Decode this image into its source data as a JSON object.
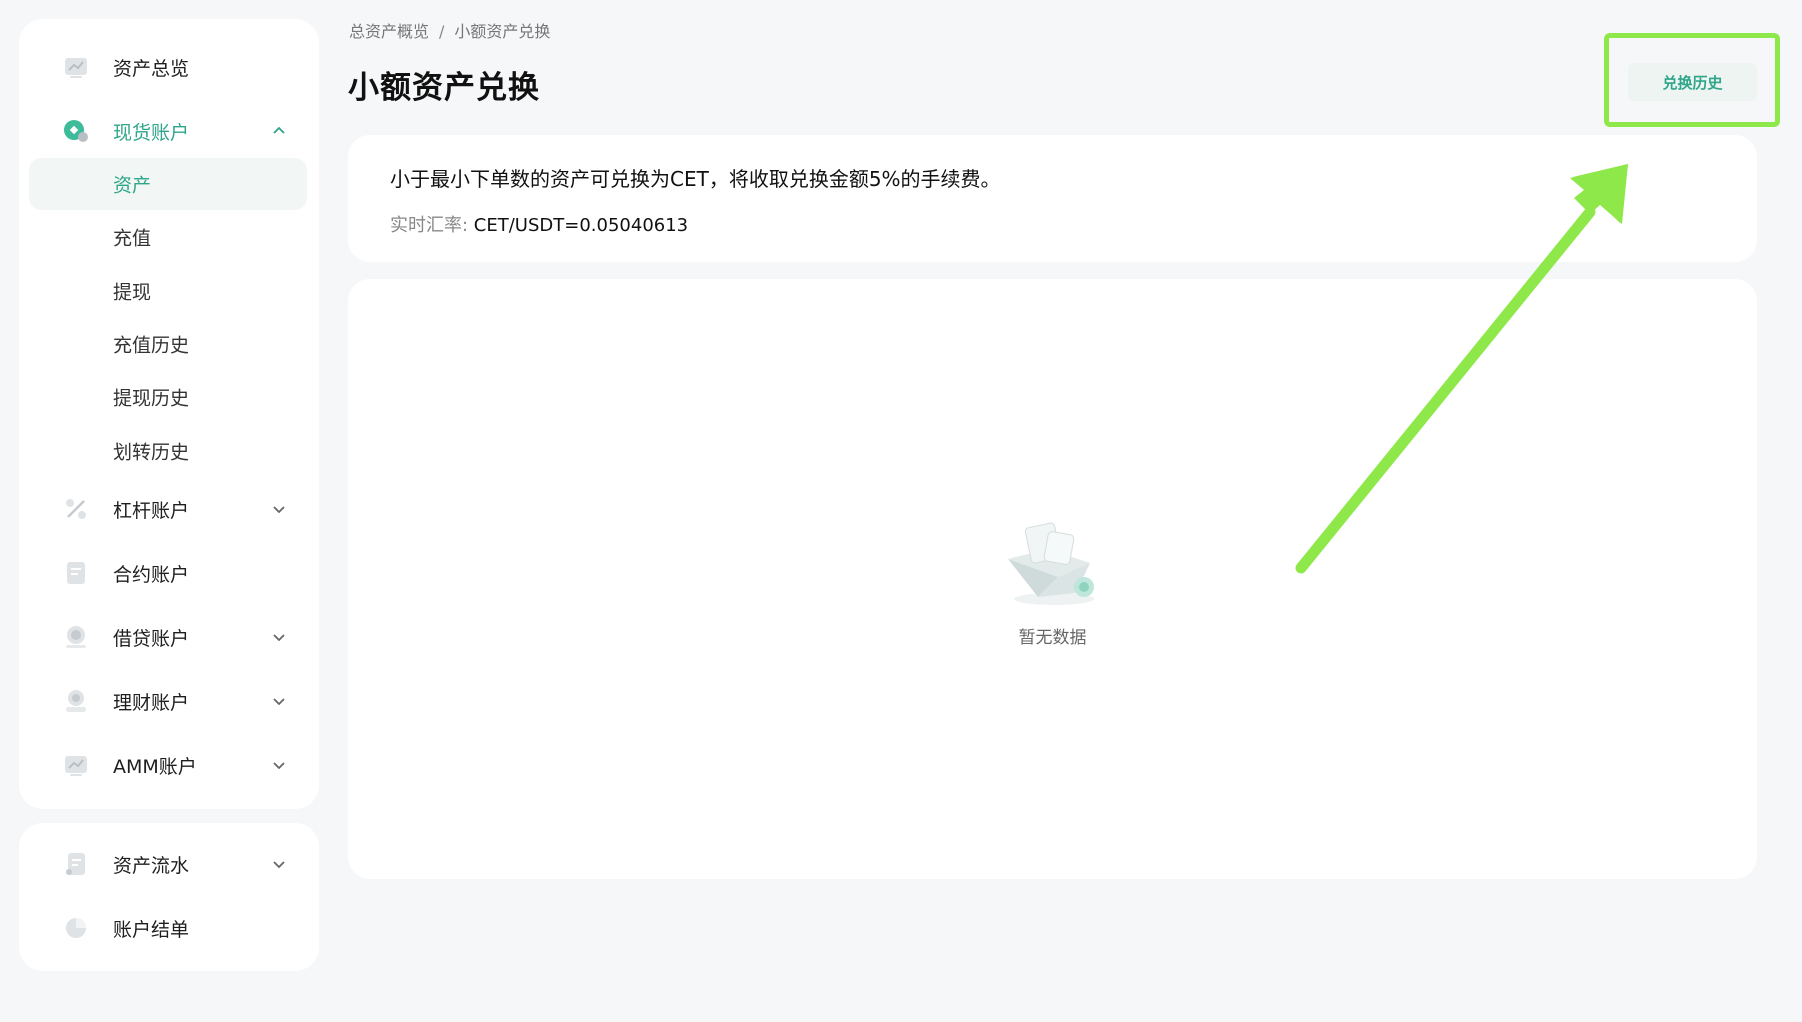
{
  "breadcrumb": {
    "root": "总资产概览",
    "separator": "/",
    "current": "小额资产兑换"
  },
  "page_title": "小额资产兑换",
  "history_button_label": "兑换历史",
  "sidebar": {
    "items": [
      {
        "key": "overview",
        "label": "资产总览",
        "icon": "overview-chart-icon",
        "chevron": null
      },
      {
        "key": "spot",
        "label": "现货账户",
        "icon": "spot-coin-icon",
        "chevron": "up",
        "active": true
      },
      {
        "key": "margin",
        "label": "杠杆账户",
        "icon": "percent-icon",
        "chevron": "down"
      },
      {
        "key": "futures",
        "label": "合约账户",
        "icon": "document-icon",
        "chevron": null
      },
      {
        "key": "loan",
        "label": "借贷账户",
        "icon": "loan-coin-icon",
        "chevron": "down"
      },
      {
        "key": "finance",
        "label": "理财账户",
        "icon": "finance-coin-icon",
        "chevron": "down"
      },
      {
        "key": "amm",
        "label": "AMM账户",
        "icon": "amm-chart-icon",
        "chevron": "down"
      }
    ],
    "spot_subitems": [
      {
        "label": "资产",
        "selected": true
      },
      {
        "label": "充值"
      },
      {
        "label": "提现"
      },
      {
        "label": "充值历史"
      },
      {
        "label": "提现历史"
      },
      {
        "label": "划转历史"
      }
    ],
    "flow_items": [
      {
        "key": "flow",
        "label": "资产流水",
        "icon": "ledger-icon",
        "chevron": "down"
      },
      {
        "key": "statement",
        "label": "账户结单",
        "icon": "pie-icon",
        "chevron": null
      }
    ]
  },
  "info": {
    "notice": "小于最小下单数的资产可兑换为CET，将收取兑换金额5%的手续费。",
    "rate_label": "实时汇率: ",
    "rate_value": "CET/USDT=0.05040613"
  },
  "empty_state": {
    "text": "暂无数据",
    "icon": "empty-box-icon"
  },
  "colors": {
    "accent": "#2fa58a",
    "highlight": "#8ee84a",
    "background": "#f6f7f9"
  }
}
